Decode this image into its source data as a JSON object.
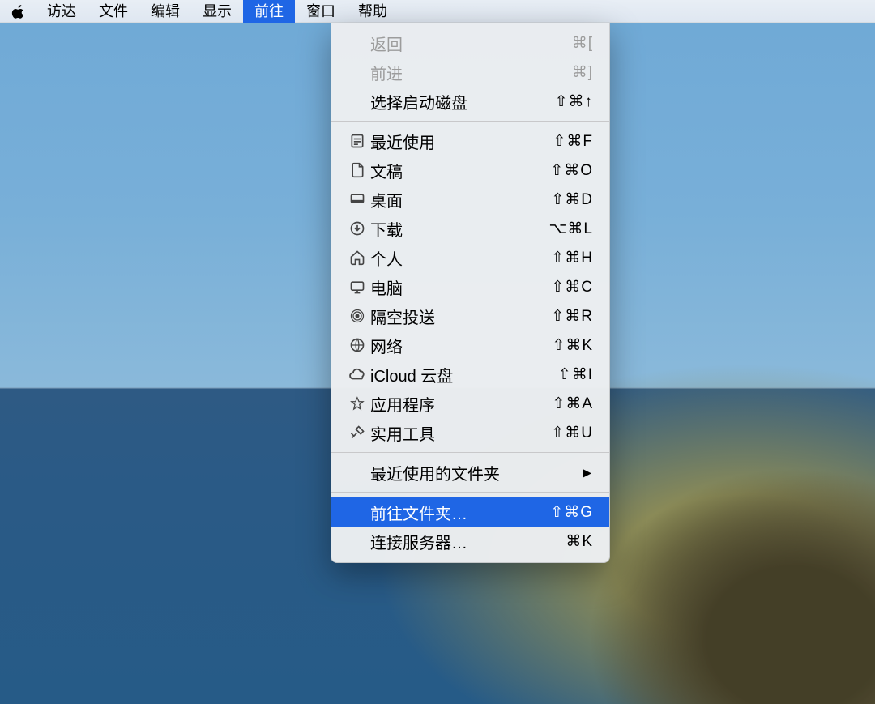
{
  "menubar": {
    "items": [
      {
        "label": "访达"
      },
      {
        "label": "文件"
      },
      {
        "label": "编辑"
      },
      {
        "label": "显示"
      },
      {
        "label": "前往",
        "active": true
      },
      {
        "label": "窗口"
      },
      {
        "label": "帮助"
      }
    ]
  },
  "dropdown": {
    "sections": [
      [
        {
          "icon": "",
          "label": "返回",
          "shortcut": "⌘[",
          "disabled": true
        },
        {
          "icon": "",
          "label": "前进",
          "shortcut": "⌘]",
          "disabled": true
        },
        {
          "icon": "",
          "label": "选择启动磁盘",
          "shortcut": "⇧⌘↑"
        }
      ],
      [
        {
          "icon": "recents",
          "label": "最近使用",
          "shortcut": "⇧⌘F"
        },
        {
          "icon": "documents",
          "label": "文稿",
          "shortcut": "⇧⌘O"
        },
        {
          "icon": "desktop",
          "label": "桌面",
          "shortcut": "⇧⌘D"
        },
        {
          "icon": "downloads",
          "label": "下载",
          "shortcut": "⌥⌘L"
        },
        {
          "icon": "home",
          "label": "个人",
          "shortcut": "⇧⌘H"
        },
        {
          "icon": "computer",
          "label": "电脑",
          "shortcut": "⇧⌘C"
        },
        {
          "icon": "airdrop",
          "label": "隔空投送",
          "shortcut": "⇧⌘R"
        },
        {
          "icon": "network",
          "label": "网络",
          "shortcut": "⇧⌘K"
        },
        {
          "icon": "icloud",
          "label": "iCloud 云盘",
          "shortcut": "⇧⌘I"
        },
        {
          "icon": "applications",
          "label": "应用程序",
          "shortcut": "⇧⌘A"
        },
        {
          "icon": "utilities",
          "label": "实用工具",
          "shortcut": "⇧⌘U"
        }
      ],
      [
        {
          "icon": "",
          "label": "最近使用的文件夹",
          "submenu": true
        }
      ],
      [
        {
          "icon": "",
          "label": "前往文件夹…",
          "shortcut": "⇧⌘G",
          "selected": true
        },
        {
          "icon": "",
          "label": "连接服务器…",
          "shortcut": "⌘K"
        }
      ]
    ]
  }
}
